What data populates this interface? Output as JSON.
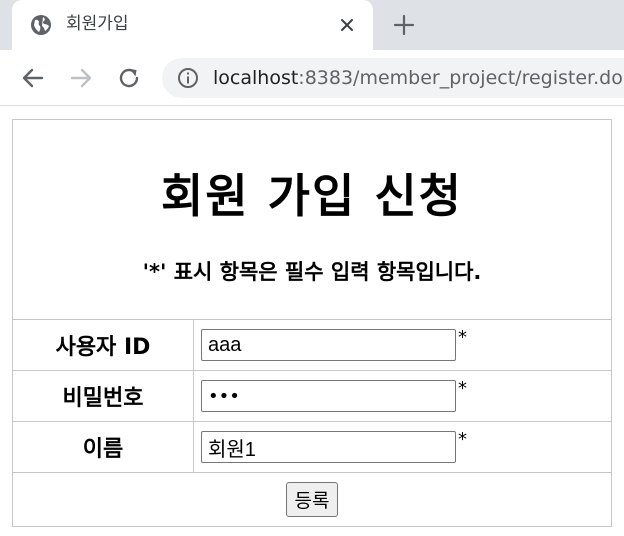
{
  "browser": {
    "tab": {
      "title": "회원가입",
      "icon": "globe-icon"
    },
    "nav": {
      "back_icon": "arrow-left-icon",
      "forward_icon": "arrow-right-icon",
      "reload_icon": "reload-icon"
    },
    "address_bar": {
      "host": "localhost",
      "rest": ":8383/member_project/register.do",
      "icon": "info-icon"
    }
  },
  "page": {
    "title": "회원 가입 신청",
    "notice": "'*' 표시 항목은 필수 입력 항목입니다.",
    "fields": [
      {
        "label": "사용자 ID",
        "value": "aaa",
        "required_mark": "*"
      },
      {
        "label": "비밀번호",
        "value": "•••",
        "required_mark": "*"
      },
      {
        "label": "이름",
        "value": "회원1",
        "required_mark": "*"
      }
    ],
    "submit_label": "등록"
  }
}
